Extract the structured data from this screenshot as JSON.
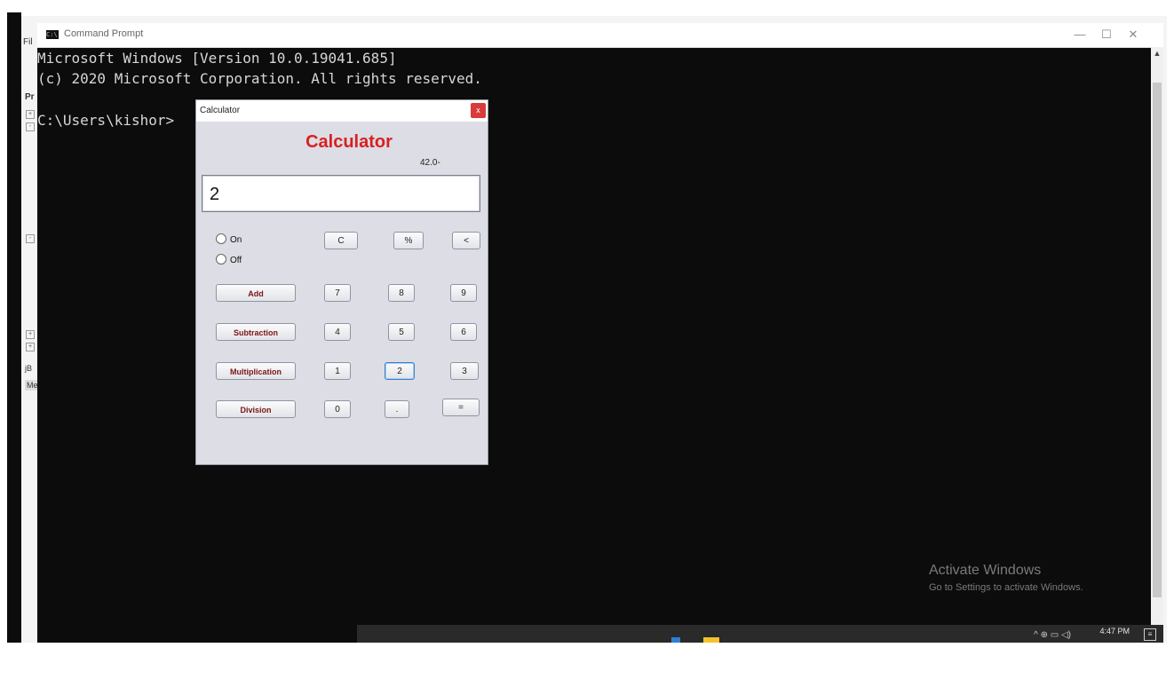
{
  "cmd": {
    "title": "Command Prompt",
    "icon": "command-prompt-icon",
    "minimize": "—",
    "maximize": "☐",
    "close": "✕",
    "lines": [
      "Microsoft Windows [Version 10.0.19041.685]",
      "(c) 2020 Microsoft Corporation. All rights reserved.",
      "C:\\Users\\kishor>"
    ]
  },
  "background_app": {
    "menu_fragment": "Fil",
    "panel_fragment": "Pr",
    "bottom_fragment_1": "jB",
    "bottom_fragment_2": "Me"
  },
  "calculator": {
    "window_title": "Calculator",
    "close_label": "x",
    "heading": "Calculator",
    "expression": "42.0-",
    "display_value": "2",
    "radio_on": "On",
    "radio_off": "Off",
    "buttons": {
      "clear": "C",
      "percent": "%",
      "backspace": "<",
      "add": "Add",
      "subtraction": "Subtraction",
      "multiplication": "Multiplication",
      "division": "Division",
      "seven": "7",
      "eight": "8",
      "nine": "9",
      "four": "4",
      "five": "5",
      "six": "6",
      "one": "1",
      "two": "2",
      "three": "3",
      "zero": "0",
      "dot": ".",
      "equals": "="
    }
  },
  "watermark": {
    "line1": "Activate Windows",
    "line2": "Go to Settings to activate Windows."
  },
  "taskbar": {
    "clock": "4:47 PM",
    "tray_icons": "^ ⊕ ▭ ◁)"
  }
}
